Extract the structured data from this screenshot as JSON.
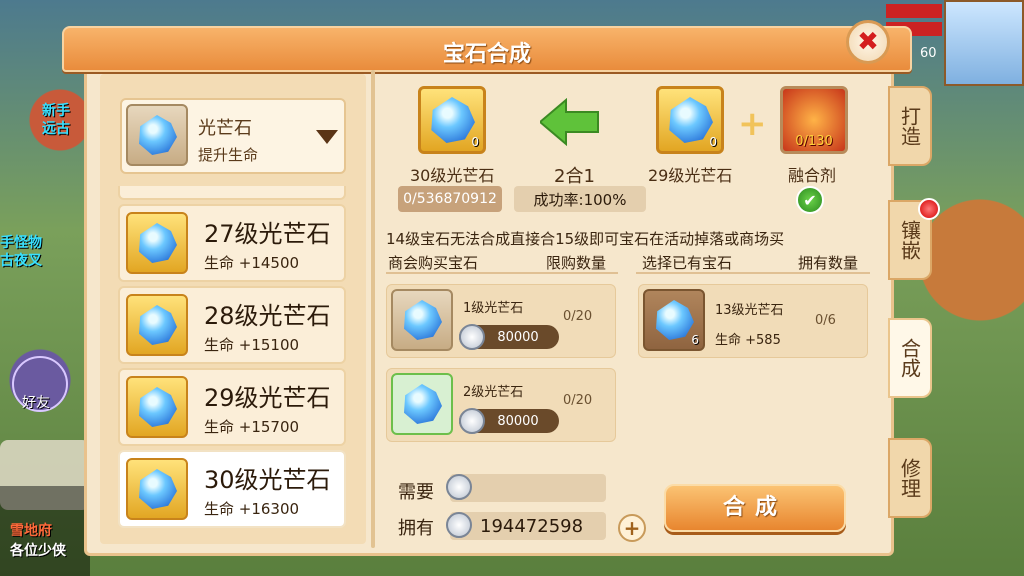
{
  "window": {
    "title": "宝石合成",
    "close_icon": "close-icon"
  },
  "background": {
    "labels": [
      {
        "text": "新手",
        "style": "cyan"
      },
      {
        "text": "远古",
        "style": "cyan"
      },
      {
        "text": "手怪物",
        "style": "cyan"
      },
      {
        "text": "古夜叉",
        "style": "cyan"
      },
      {
        "text": "好友",
        "style": "white"
      },
      {
        "text": "雪地府",
        "style": "red"
      },
      {
        "text": "各位少侠",
        "style": "white"
      }
    ],
    "level": "60"
  },
  "selector": {
    "name": "光芒石",
    "subtitle": "提升生命"
  },
  "gem_list": [
    {
      "name": "27级光芒石",
      "stat": "生命 +14500"
    },
    {
      "name": "28级光芒石",
      "stat": "生命 +15100"
    },
    {
      "name": "29级光芒石",
      "stat": "生命 +15700"
    },
    {
      "name": "30级光芒石",
      "stat": "生命 +16300"
    }
  ],
  "compose": {
    "target_name": "30级光芒石",
    "target_count": "0",
    "target_progress": "0/536870912",
    "ratio": "2合1",
    "success_rate": "成功率:100%",
    "source_name": "29级光芒石",
    "source_count": "0",
    "flux_name": "融合剂",
    "flux_count": "0/130"
  },
  "notice": "14级宝石无法合成直接合15级即可宝石在活动掉落或商场买",
  "shop_headers": {
    "col1": "商会购买宝石",
    "col2": "限购数量"
  },
  "owned_headers": {
    "col1": "选择已有宝石",
    "col2": "拥有数量"
  },
  "shop_items": [
    {
      "name": "1级光芒石",
      "limit": "0/20",
      "price": "80000"
    },
    {
      "name": "2级光芒石",
      "limit": "0/20",
      "price": "80000"
    }
  ],
  "owned_items": [
    {
      "name": "13级光芒石",
      "count_badge": "6",
      "stat": "生命 +585",
      "owned": "0/6"
    }
  ],
  "bottom": {
    "need_label": "需要",
    "need_value": "",
    "have_label": "拥有",
    "have_value": "194472598",
    "compose_button": "合成"
  },
  "tabs": [
    {
      "label": "打造",
      "active": false
    },
    {
      "label": "镶嵌",
      "active": false,
      "red_dot": true
    },
    {
      "label": "合成",
      "active": true
    },
    {
      "label": "修理",
      "active": false
    }
  ],
  "colors": {
    "title_bar": "#e98c3c",
    "panel": "#f6e7cc",
    "accent_green": "#2a8a1e",
    "badge_red": "#d40000"
  }
}
